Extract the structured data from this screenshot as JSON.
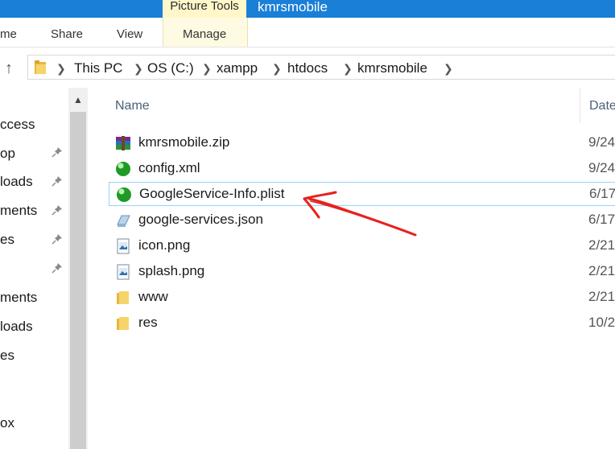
{
  "titlebar": {
    "context_tab": "Picture Tools",
    "window_title": "kmrsmobile",
    "color": "#1a7fd6"
  },
  "ribbon": {
    "tabs": [
      "me",
      "Share",
      "View"
    ],
    "context_tab": "Manage"
  },
  "address": {
    "crumbs": [
      "This PC",
      "OS (C:)",
      "xampp",
      "htdocs",
      "kmrsmobile"
    ]
  },
  "nav": {
    "items": [
      "ccess",
      "op",
      "loads",
      "ments",
      "es",
      "",
      "ments",
      "loads",
      "es",
      "",
      "ox"
    ]
  },
  "list": {
    "col_name": "Name",
    "col_date": "Date",
    "files": [
      {
        "name": "kmrsmobile.zip",
        "date": "9/24",
        "icon": "winrar-archive-icon"
      },
      {
        "name": "config.xml",
        "date": "9/24",
        "icon": "green-sphere-icon"
      },
      {
        "name": "GoogleService-Info.plist",
        "date": "6/17",
        "icon": "green-sphere-icon"
      },
      {
        "name": "google-services.json",
        "date": "6/17",
        "icon": "json-file-icon"
      },
      {
        "name": "icon.png",
        "date": "2/21",
        "icon": "image-file-icon"
      },
      {
        "name": "splash.png",
        "date": "2/21",
        "icon": "image-file-icon"
      },
      {
        "name": "www",
        "date": "2/21",
        "icon": "folder-icon"
      },
      {
        "name": "res",
        "date": "10/2",
        "icon": "folder-icon"
      }
    ],
    "selected_index": 2
  },
  "annotation": {
    "color": "#e8211d"
  }
}
